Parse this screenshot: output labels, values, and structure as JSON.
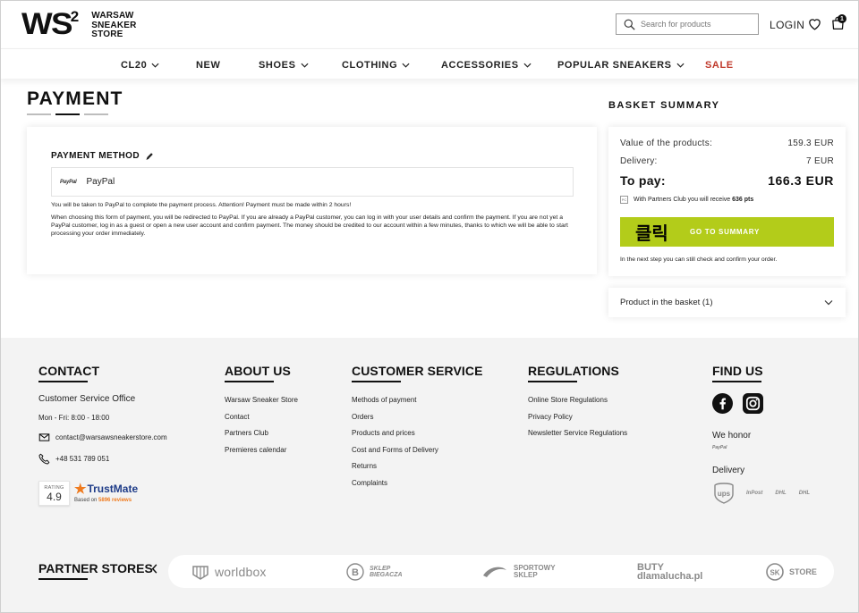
{
  "header": {
    "logo_mark": "WS",
    "logo_sup": "2",
    "logo_line1": "WARSAW",
    "logo_line2": "SNEAKER",
    "logo_line3": "STORE",
    "search_placeholder": "Search for products",
    "login_label": "LOGIN",
    "cart_count": "1"
  },
  "nav": {
    "items": [
      "CL20",
      "NEW",
      "SHOES",
      "CLOTHING",
      "ACCESSORIES",
      "POPULAR SNEAKERS",
      "SALE"
    ],
    "sale_color": "#c0392b"
  },
  "payment": {
    "title": "PAYMENT",
    "method_title": "PAYMENT METHOD",
    "paypal_logo": "PayPal",
    "method_label": "PayPal",
    "text1": "You will be taken to PayPal to complete the payment process. Attention! Payment must be made within 2 hours!",
    "text2": "When choosing this form of payment, you will be redirected to PayPal. If you are already a PayPal customer, you can log in with your user details and confirm the payment. If you are not yet a PayPal customer, log in as a guest or open a new user account and confirm payment. The money should be credited to our account within a few minutes, thanks to which we will be able to start processing your order immediately."
  },
  "summary": {
    "title": "BASKET SUMMARY",
    "products_label": "Value of the products:",
    "products_value": "159.3 EUR",
    "delivery_label": "Delivery:",
    "delivery_value": "7 EUR",
    "topay_label": "To pay:",
    "topay_value": "166.3 EUR",
    "pc_badge": "PC",
    "pc_text": "With Partners Club you will receive",
    "pc_points": "636 pts",
    "button_overlay": "클릭",
    "button_label": "GO TO SUMMARY",
    "button_color": "#b3cc1a",
    "note": "In the next step you can still check and confirm your order.",
    "basket_product": "Product in the basket (1)"
  },
  "footer": {
    "contact": {
      "title": "CONTACT",
      "office": "Customer Service Office",
      "hours": "Mon - Fri: 8:00 - 18:00",
      "email": "contact@warsawsneakerstore.com",
      "phone": "+48 531 789 051"
    },
    "trustmate": {
      "rating_label": "RATING",
      "rating_value": "4.9",
      "brand": "TrustMate",
      "based_on": "Based on",
      "reviews": "5896 reviews"
    },
    "about": {
      "title": "ABOUT US",
      "links": [
        "Warsaw Sneaker Store",
        "Contact",
        "Partners Club",
        "Premieres calendar"
      ]
    },
    "customer_service": {
      "title": "CUSTOMER SERVICE",
      "links": [
        "Methods of payment",
        "Orders",
        "Products and prices",
        "Cost and Forms of Delivery",
        "Returns",
        "Complaints"
      ]
    },
    "regulations": {
      "title": "REGULATIONS",
      "links": [
        "Online Store Regulations",
        "Privacy Policy",
        "Newsletter Service Regulations"
      ]
    },
    "find_us": {
      "title": "FIND US",
      "honor_title": "We honor",
      "honor_paypal": "PayPal",
      "delivery_title": "Delivery",
      "delivery_logos": [
        "ups",
        "InPost",
        "DHL",
        "DHL"
      ]
    },
    "partners": {
      "title": "PARTNER STORES",
      "stores": [
        "worldbox",
        "SKLEP BIEGACZA",
        "SPORTOWY SKLEP",
        "BUTY dlamalucha.pl",
        "STORE"
      ]
    }
  }
}
